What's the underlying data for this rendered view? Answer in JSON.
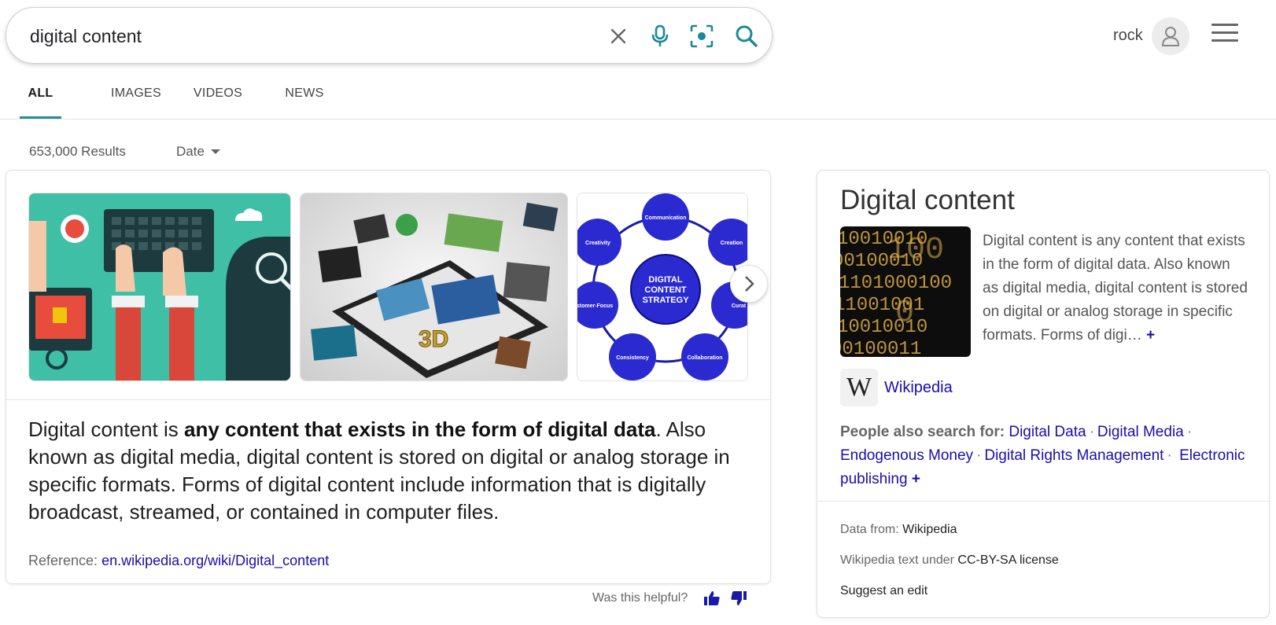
{
  "search": {
    "query": "digital content"
  },
  "user": {
    "name": "rock"
  },
  "tabs": [
    {
      "label": "ALL",
      "active": true
    },
    {
      "label": "IMAGES",
      "active": false
    },
    {
      "label": "VIDEOS",
      "active": false
    },
    {
      "label": "NEWS",
      "active": false
    }
  ],
  "results": {
    "count": "653,000 Results",
    "date_filter": "Date"
  },
  "answer": {
    "snippet_pre": "Digital content is ",
    "snippet_bold": "any content that exists in the form of digital data",
    "snippet_post": ". Also known as digital media, digital content is stored on digital or analog storage in specific formats. Forms of digital content include information that is digitally broadcast, streamed, or contained in computer files.",
    "reference_label": "Reference: ",
    "reference_url": "en.wikipedia.org/wiki/Digital_content",
    "image3_text": {
      "center": "DIGITAL CONTENT STRATEGY",
      "nodes": [
        "Communication",
        "Creation",
        "Curat",
        "Collaboration",
        "Consistency",
        "stomer-Focus",
        "Creativity"
      ]
    },
    "image2_badge": "3D"
  },
  "feedback": {
    "question": "Was this helpful?"
  },
  "knowledge_panel": {
    "title": "Digital content",
    "description": "Digital content is any content that exists in the form of digital data. Also known as digital media, digital content is stored on digital or analog storage in specific formats. Forms of digi…",
    "more": "+",
    "source_link": "Wikipedia",
    "people_also_search_label": "People also search for:",
    "people_also_search": [
      "Digital Data",
      "Digital Media",
      "Endogenous Money",
      "Digital Rights Management",
      "Electronic publishing"
    ],
    "more_searches": "+",
    "data_from_label": "Data from: ",
    "data_from_value": "Wikipedia",
    "license_label": "Wikipedia text under ",
    "license_value": "CC-BY-SA license",
    "suggest_edit": "Suggest an edit"
  },
  "colors": {
    "accent": "#2a8a97",
    "link": "#1a0dab",
    "icon_teal": "#1a8a98"
  }
}
